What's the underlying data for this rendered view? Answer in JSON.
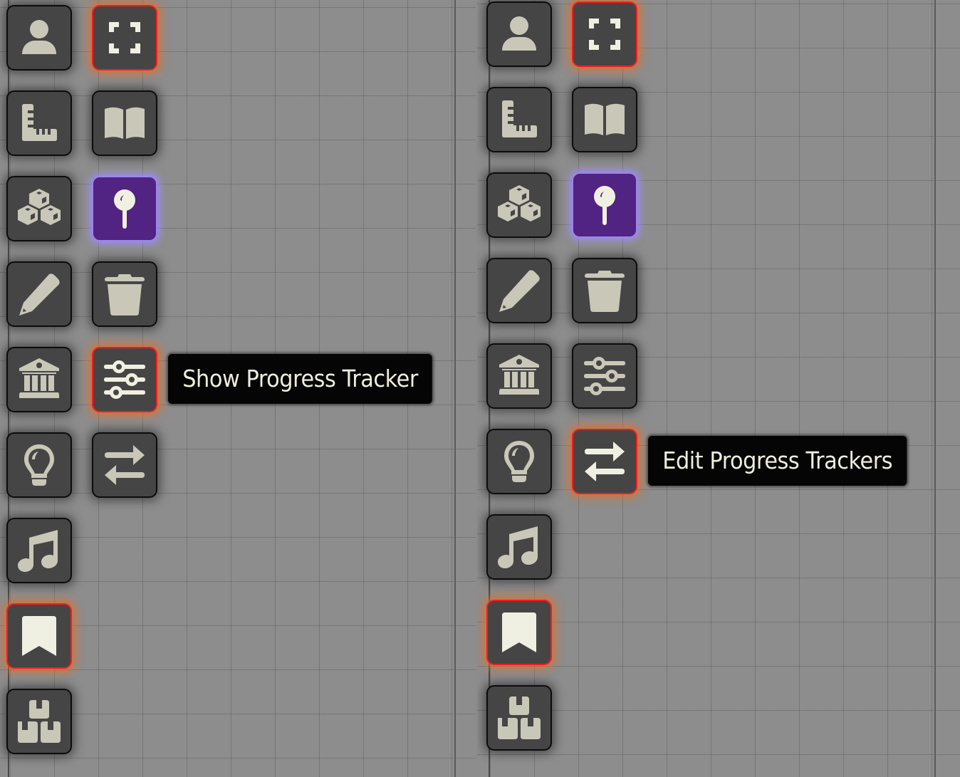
{
  "colors": {
    "canvas": "#8d8d8d",
    "button_bg": "#454545",
    "button_border": "#0c0c0c",
    "icon": "#c9c7b8",
    "icon_active": "#f0f0e2",
    "active_border": "#ff1a1a",
    "active_glow": "#e66e28",
    "selected_bg": "#512382",
    "selected_border": "#9a86f0",
    "tooltip_bg": "#050505",
    "tooltip_text": "#eeeede"
  },
  "panels": [
    {
      "id": "left",
      "tooltip": "Show Progress Tracker",
      "hovered_button": "progress-tracker"
    },
    {
      "id": "right",
      "tooltip": "Edit Progress Trackers",
      "hovered_button": "swap-trackers"
    }
  ],
  "toolbar": {
    "column_1": [
      {
        "id": "token",
        "icon": "user-icon",
        "state": "normal"
      },
      {
        "id": "measure",
        "icon": "ruler-icon",
        "state": "normal"
      },
      {
        "id": "drawings",
        "icon": "cubes-icon",
        "state": "normal"
      },
      {
        "id": "notes",
        "icon": "pencil-icon",
        "state": "normal"
      },
      {
        "id": "tiles",
        "icon": "landmark-icon",
        "state": "normal"
      },
      {
        "id": "lighting",
        "icon": "lightbulb-icon",
        "state": "normal"
      },
      {
        "id": "sounds",
        "icon": "music-icon",
        "state": "normal"
      },
      {
        "id": "bookmarks",
        "icon": "bookmark-icon",
        "state": "active"
      },
      {
        "id": "boxes",
        "icon": "boxes-icon",
        "state": "normal"
      }
    ],
    "column_2": [
      {
        "id": "fullscreen",
        "icon": "expand-icon",
        "state": "active"
      },
      {
        "id": "journal",
        "icon": "book-open-icon",
        "state": "normal"
      },
      {
        "id": "pin",
        "icon": "map-pin-icon",
        "state": "selected"
      },
      {
        "id": "delete",
        "icon": "trash-icon",
        "state": "normal"
      },
      {
        "id": "progress-tracker",
        "icon": "sliders-icon",
        "state": "normal"
      },
      {
        "id": "swap-trackers",
        "icon": "arrows-swap-icon",
        "state": "normal"
      }
    ]
  }
}
